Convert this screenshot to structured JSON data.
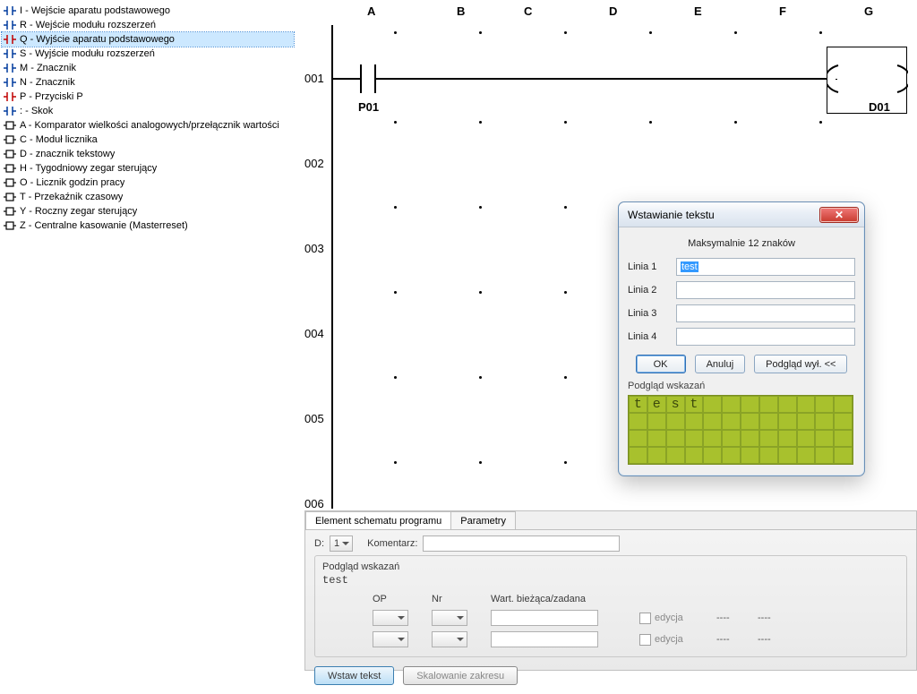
{
  "tree": {
    "items": [
      {
        "type": "contact",
        "label": "I - Wejście aparatu podstawowego"
      },
      {
        "type": "contact",
        "label": "R - Wejście modułu rozszerzeń"
      },
      {
        "type": "contact-red",
        "label": "Q - Wyjście aparatu podstawowego",
        "selected": true
      },
      {
        "type": "contact",
        "label": "S - Wyjście modułu rozszerzeń"
      },
      {
        "type": "contact",
        "label": "M - Znacznik"
      },
      {
        "type": "contact",
        "label": "N - Znacznik"
      },
      {
        "type": "contact-red",
        "label": "P - Przyciski P"
      },
      {
        "type": "contact",
        "label": ": - Skok"
      },
      {
        "type": "fb",
        "label": "A - Komparator wielkości analogowych/przełącznik wartości"
      },
      {
        "type": "fb",
        "label": "C - Moduł licznika"
      },
      {
        "type": "fb",
        "label": "D - znacznik tekstowy"
      },
      {
        "type": "fb",
        "label": "H - Tygodniowy zegar sterujący"
      },
      {
        "type": "fb",
        "label": "O - Licznik godzin pracy"
      },
      {
        "type": "fb",
        "label": "T - Przekaźnik czasowy"
      },
      {
        "type": "fb",
        "label": "Y - Roczny zegar sterujący"
      },
      {
        "type": "fb",
        "label": "Z - Centralne kasowanie (Masterreset)"
      }
    ]
  },
  "ladder": {
    "cols": [
      "A",
      "B",
      "C",
      "D",
      "E",
      "F",
      "G"
    ],
    "rows": [
      "001",
      "002",
      "003",
      "004",
      "005",
      "006"
    ],
    "contact_label": "P01",
    "coil_label": "D01"
  },
  "bottom": {
    "tabs": {
      "t1": "Element schematu programu",
      "t2": "Parametry"
    },
    "d_label": "D:",
    "d_val": "1",
    "kom_label": "Komentarz:",
    "preview_label": "Podgląd wskazań",
    "preview_text": "test",
    "th": {
      "op": "OP",
      "nr": "Nr",
      "wart": "Wart. bieżąca/zadana"
    },
    "edycja": "edycja",
    "dashes": "----",
    "btn_wstaw": "Wstaw tekst",
    "btn_skal": "Skalowanie zakresu"
  },
  "dialog": {
    "title": "Wstawianie tekstu",
    "hint": "Maksymalnie 12 znaków",
    "l1": "Linia 1",
    "l2": "Linia 2",
    "l3": "Linia 3",
    "l4": "Linia 4",
    "val1": "test",
    "ok": "OK",
    "anuluj": "Anuluj",
    "podglad": "Podgląd wył. <<",
    "preview": "Podgląd wskazań",
    "lcd_text": "test"
  }
}
